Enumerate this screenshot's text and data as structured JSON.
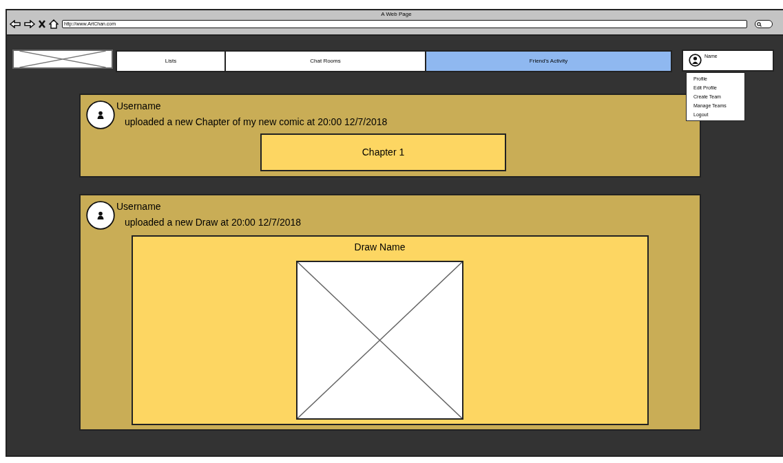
{
  "browser": {
    "title": "A Web Page",
    "url": "http://www.ArtChan.com"
  },
  "nav": {
    "tabs": [
      {
        "label": "Lists",
        "selected": false
      },
      {
        "label": "Chat Rooms",
        "selected": false
      },
      {
        "label": "Friend's Activity",
        "selected": true
      }
    ]
  },
  "user": {
    "name": "Name",
    "menu": [
      "Profile",
      "Edit Profile",
      "Create Team",
      "Manage Teams",
      "Logout"
    ]
  },
  "posts": [
    {
      "kind": "chapter",
      "username": "Username",
      "text": "uploaded a new Chapter of my new comic at 20:00 12/7/2018",
      "chapter": "Chapter 1"
    },
    {
      "kind": "draw",
      "username": "Username",
      "text": "uploaded a new Draw at 20:00 12/7/2018",
      "draw_name": "Draw Name"
    }
  ]
}
